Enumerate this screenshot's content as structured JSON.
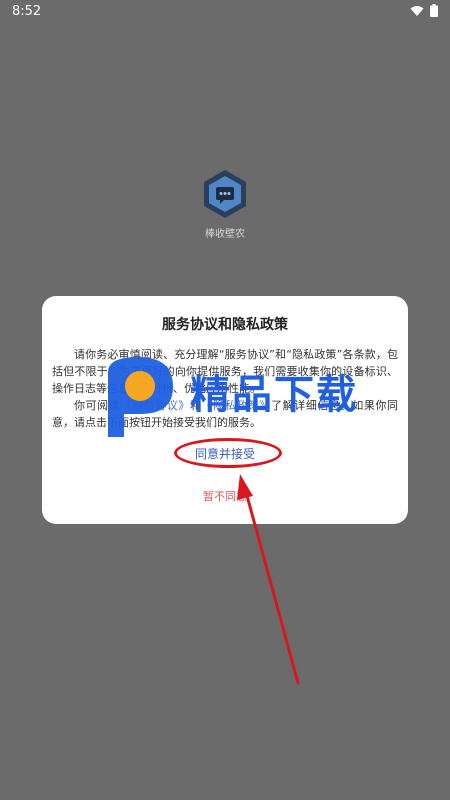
{
  "status_bar": {
    "time": "8:52"
  },
  "app": {
    "name": "棒收壁农"
  },
  "dialog": {
    "title": "服务协议和隐私政策",
    "paragraph1": "请你务必审慎阅读、充分理解“服务协议”和“隐私政策”各条款，包括但不限于：为了更好的向你提供服务，我们需要收集你的设备标识、操作日志等信息用于分析、优化应用性能。",
    "paragraph2_prefix": "你可阅读",
    "link_service": "《服务协议》",
    "paragraph2_and": "和",
    "link_privacy": "《隐私政策》",
    "paragraph2_suffix": "了解详细信息。如果你同意，请点击下面按钮开始接受我们的服务。",
    "agree_label": "同意并接受",
    "disagree_label": "暂不同意"
  },
  "watermark": {
    "text": "精品下载"
  },
  "colors": {
    "overlay": "#6b6b6b",
    "link": "#4a6fd1",
    "agree": "#3a5bb8",
    "disagree": "#e05555",
    "annotation": "#d8181e",
    "watermark_blue": "#1f5fe0",
    "watermark_orange": "#f5a623"
  }
}
